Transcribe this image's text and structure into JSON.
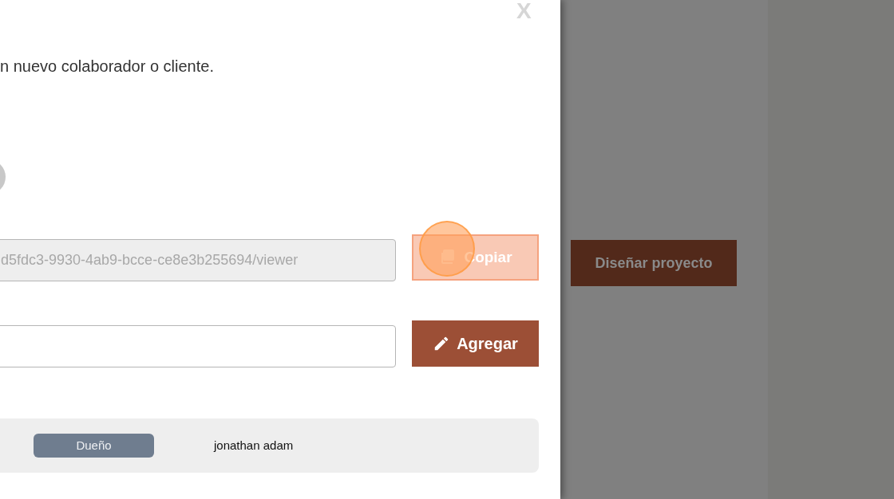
{
  "modal": {
    "close": "X",
    "description": "n nuevo colaborador o cliente.",
    "share_link": {
      "value": "d5fdc3-9930-4ab9-bcce-ce8e3b255694/viewer",
      "button": "Copiar"
    },
    "invite": {
      "button": "Agregar"
    },
    "members": [
      {
        "role": "Dueño",
        "name": "jonathan adam"
      }
    ]
  },
  "background": {
    "button": "Diseñar proyecto"
  }
}
